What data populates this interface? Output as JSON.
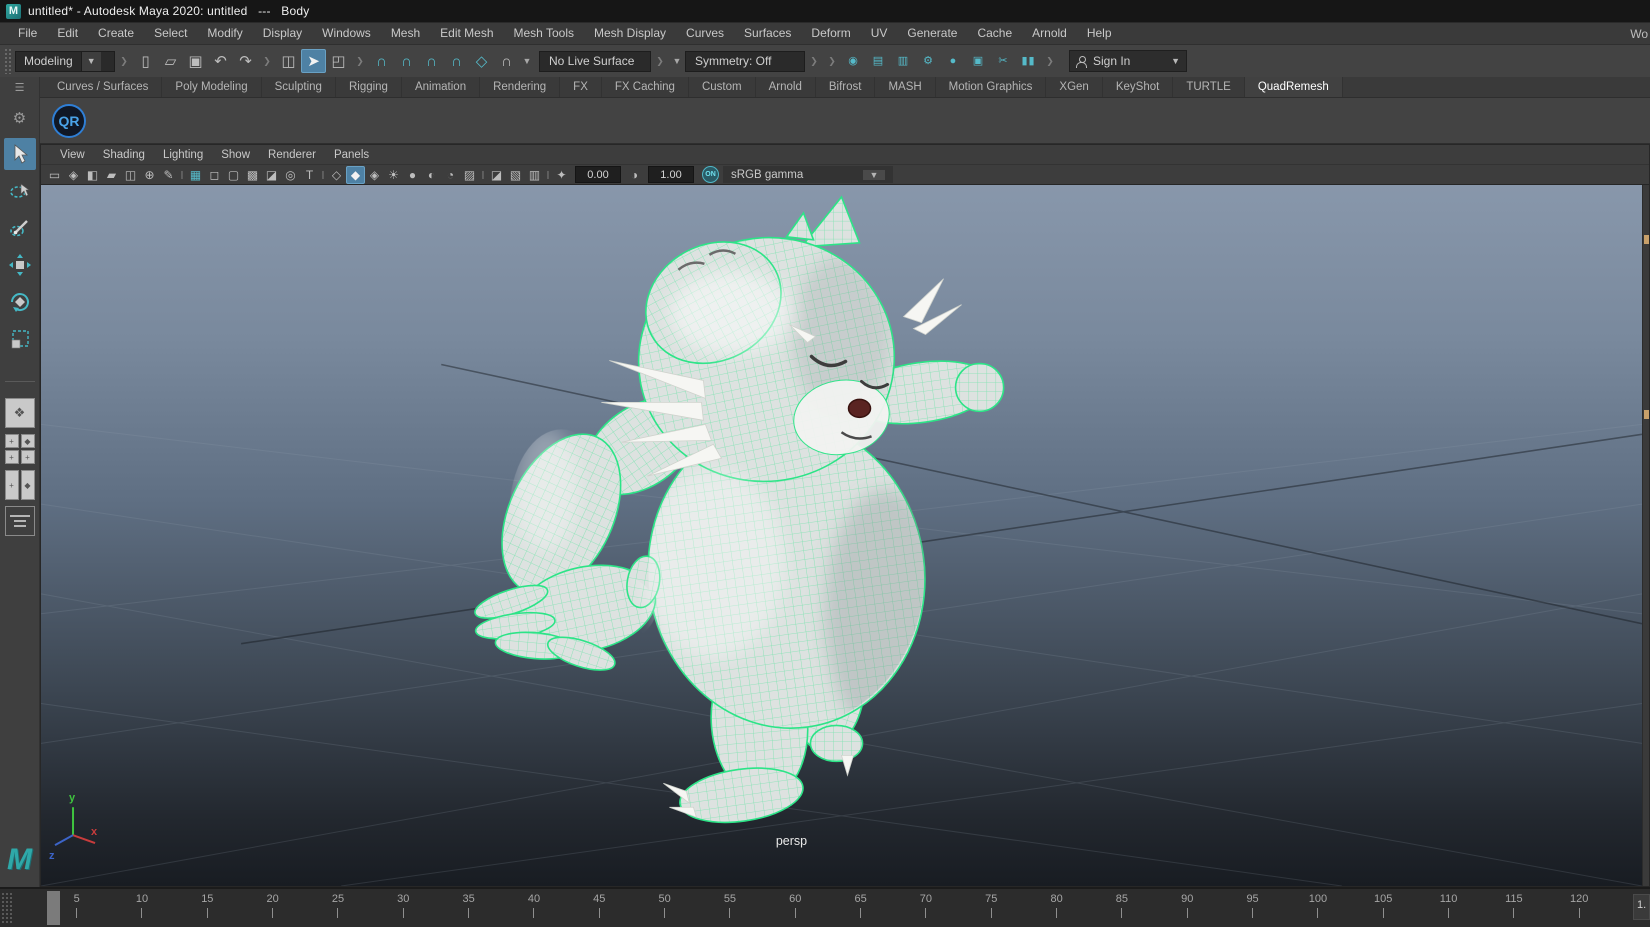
{
  "window": {
    "app_icon_letter": "M",
    "title": "untitled* - Autodesk Maya 2020: untitled   ---   Body"
  },
  "menu_bar": {
    "items": [
      "File",
      "Edit",
      "Create",
      "Select",
      "Modify",
      "Display",
      "Windows",
      "Mesh",
      "Edit Mesh",
      "Mesh Tools",
      "Mesh Display",
      "Curves",
      "Surfaces",
      "Deform",
      "UV",
      "Generate",
      "Cache",
      "Arnold",
      "Help"
    ],
    "workspace_partial": "Wo"
  },
  "status_line": {
    "menu_set": "Modeling",
    "file_icons": [
      {
        "name": "new-scene-icon",
        "glyph": "▯"
      },
      {
        "name": "open-scene-icon",
        "glyph": "▱"
      },
      {
        "name": "save-scene-icon",
        "glyph": "▣"
      },
      {
        "name": "undo-icon",
        "glyph": "↶"
      },
      {
        "name": "redo-icon",
        "glyph": "↷"
      }
    ],
    "selection_icons": [
      {
        "name": "select-by-hierarchy-icon",
        "glyph": "◫"
      },
      {
        "name": "select-by-object-icon",
        "glyph": "➤",
        "mod": "active"
      },
      {
        "name": "select-by-component-icon",
        "glyph": "◰"
      }
    ],
    "snap_icons": [
      {
        "name": "snap-to-grid-icon",
        "glyph": "∩",
        "mod": "teal"
      },
      {
        "name": "snap-to-curve-icon",
        "glyph": "∩",
        "mod": "teal"
      },
      {
        "name": "snap-to-point-icon",
        "glyph": "∩",
        "mod": "teal"
      },
      {
        "name": "snap-to-projected-center-icon",
        "glyph": "∩",
        "mod": "teal"
      },
      {
        "name": "make-live-icon",
        "glyph": "◇",
        "mod": "teal"
      },
      {
        "name": "snap-to-view-plane-icon",
        "glyph": "∩"
      }
    ],
    "live_surface": "No Live Surface",
    "symmetry": "Symmetry: Off",
    "render_icons": [
      {
        "name": "render-view-icon",
        "glyph": "◉",
        "mod": "teal"
      },
      {
        "name": "render-current-frame-icon",
        "glyph": "▤",
        "mod": "teal"
      },
      {
        "name": "ipr-render-icon",
        "glyph": "▥",
        "mod": "teal"
      },
      {
        "name": "render-settings-icon",
        "glyph": "⚙",
        "mod": "teal"
      },
      {
        "name": "hypershade-icon",
        "glyph": "●",
        "mod": "teal"
      },
      {
        "name": "light-editor-icon",
        "glyph": "▣",
        "mod": "teal"
      },
      {
        "name": "node-editor-icon",
        "glyph": "✂",
        "mod": "teal"
      },
      {
        "name": "pause-icon",
        "glyph": "▮▮",
        "mod": "teal"
      }
    ],
    "sign_in": "Sign In"
  },
  "shelf": {
    "tabs": [
      {
        "label": "Curves / Surfaces"
      },
      {
        "label": "Poly Modeling"
      },
      {
        "label": "Sculpting"
      },
      {
        "label": "Rigging"
      },
      {
        "label": "Animation"
      },
      {
        "label": "Rendering"
      },
      {
        "label": "FX"
      },
      {
        "label": "FX Caching"
      },
      {
        "label": "Custom"
      },
      {
        "label": "Arnold"
      },
      {
        "label": "Bifrost"
      },
      {
        "label": "MASH"
      },
      {
        "label": "Motion Graphics"
      },
      {
        "label": "XGen"
      },
      {
        "label": "KeyShot"
      },
      {
        "label": "TURTLE"
      },
      {
        "label": "QuadRemesh",
        "mod": "active"
      }
    ],
    "qr_button": "QR"
  },
  "panel": {
    "menus": [
      "View",
      "Shading",
      "Lighting",
      "Show",
      "Renderer",
      "Panels"
    ],
    "icons_a": [
      {
        "name": "select-camera-icon",
        "glyph": "▭"
      },
      {
        "name": "lock-camera-icon",
        "glyph": "◈"
      },
      {
        "name": "camera-attributes-icon",
        "glyph": "◧"
      },
      {
        "name": "bookmark-icon",
        "glyph": "▰"
      },
      {
        "name": "image-plane-icon",
        "glyph": "◫"
      },
      {
        "name": "two-d-pan-zoom-icon",
        "glyph": "⊕"
      },
      {
        "name": "greasepencil-icon",
        "glyph": "✎"
      }
    ],
    "icons_b": [
      {
        "name": "grid-icon",
        "glyph": "▦",
        "mod": "teal"
      },
      {
        "name": "film-gate-icon",
        "glyph": "◻"
      },
      {
        "name": "resolution-gate-icon",
        "glyph": "▢"
      },
      {
        "name": "gate-mask-icon",
        "glyph": "▩"
      },
      {
        "name": "field-chart-icon",
        "glyph": "◪"
      },
      {
        "name": "safe-action-icon",
        "glyph": "◎"
      },
      {
        "name": "safe-title-icon",
        "glyph": "T"
      }
    ],
    "icons_c": [
      {
        "name": "wireframe-mode-icon",
        "glyph": "◇"
      },
      {
        "name": "shaded-mode-icon",
        "glyph": "◆",
        "mod": "active"
      },
      {
        "name": "textured-mode-icon",
        "glyph": "◈"
      },
      {
        "name": "use-all-lights-icon",
        "glyph": "☀"
      },
      {
        "name": "shadows-icon",
        "glyph": "●"
      },
      {
        "name": "occlusion-icon",
        "glyph": "◐"
      },
      {
        "name": "motion-blur-icon",
        "glyph": "◔"
      },
      {
        "name": "multisample-icon",
        "glyph": "▨"
      }
    ],
    "icons_d": [
      {
        "name": "isolate-select-icon",
        "glyph": "◪"
      },
      {
        "name": "xray-icon",
        "glyph": "▧"
      },
      {
        "name": "joints-xray-icon",
        "glyph": "▥"
      }
    ],
    "exposure": "0.00",
    "gamma": "1.00",
    "on_badge": "ON",
    "view_transform": "sRGB gamma",
    "camera_label": "persp"
  },
  "viewport": {
    "axis_x": "x",
    "axis_y": "y",
    "axis_z": "z"
  },
  "time_slider": {
    "ticks": [
      5,
      10,
      15,
      20,
      25,
      30,
      35,
      40,
      45,
      50,
      55,
      60,
      65,
      70,
      75,
      80,
      85,
      90,
      95,
      100,
      105,
      110,
      115,
      120
    ],
    "current_frame": "1."
  },
  "colors": {
    "accent_blue": "#4e81a4",
    "icon_teal": "#55bac9",
    "wireframe_green": "#2ce487",
    "maya_teal": "#2fa8a8",
    "viewport_top": "#8897ab",
    "viewport_bottom": "#181c22"
  }
}
